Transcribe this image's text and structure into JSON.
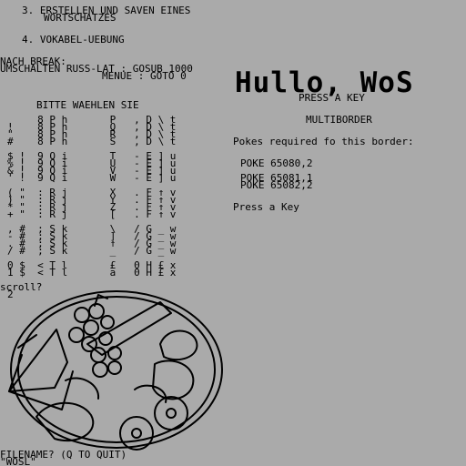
{
  "menu": {
    "item3_line1": "3. ERSTELLEN UND SAVEN EINES",
    "item3_line2": "WORTSCHATZES",
    "item4": "4. VOKABEL-UEBUNG",
    "break_title": "NACH BREAK:",
    "break_line1": "UMSCHALTEN RUSS-LAT : GOSUB 1000",
    "break_line2": "MENUE : GOTO 0"
  },
  "charset": {
    "prompt": "BITTE WAEHLEN SIE",
    "rows": [
      "     8 P h       P   , D \\ t",
      "!    8 P h       Q   , D \\ t",
      "\"    8 P h       R   , D \\ t",
      "#    8 P h       S   , D \\ t",
      "$ !  9 Q i       T   - E ] u",
      "% !  9 Q i       U   - E ] u",
      "& !  9 Q i       V   - E ] u",
      "' !  9 Q i       W   - E ] u",
      "( \"  : R j       X   . F ↑ v",
      ") \"  : R j       Y   . F ↑ v",
      "* \"  : R j       Z   . F ↑ v",
      "+ \"  : R j       [   . F ↑ v",
      ", #  ; S k       \\   / G _ w",
      "- #  ; S k       ]   / G _ w",
      ". #  ; S k       ↑   / G _ w",
      "/ #  ; S k       _   / G _ w",
      "0 $  < T l       £   0 H £ x",
      "1 $  < T l       a   0 H £ x"
    ]
  },
  "right_panel": {
    "big_title": "Hullo, WoS",
    "press_key": "PRESS A KEY",
    "multiborder": "MULTIBORDER",
    "pokes_required": "Pokes required fo this border:",
    "poke1": "POKE 65080,2",
    "poke2": "POKE 65081,1",
    "poke3": "POKE 65082,2",
    "press_a_key": "Press a Key"
  },
  "scroll": {
    "question": "scroll?",
    "answer": "2"
  },
  "picture": {
    "name": "fruit-bowl-line-drawing"
  },
  "bottom": {
    "filename_prompt": "FILENAME? (Q TO QUIT)",
    "filename_value": "\"WOSL\""
  },
  "colors": {
    "background": "#aaaaaa",
    "ink": "#000000"
  }
}
